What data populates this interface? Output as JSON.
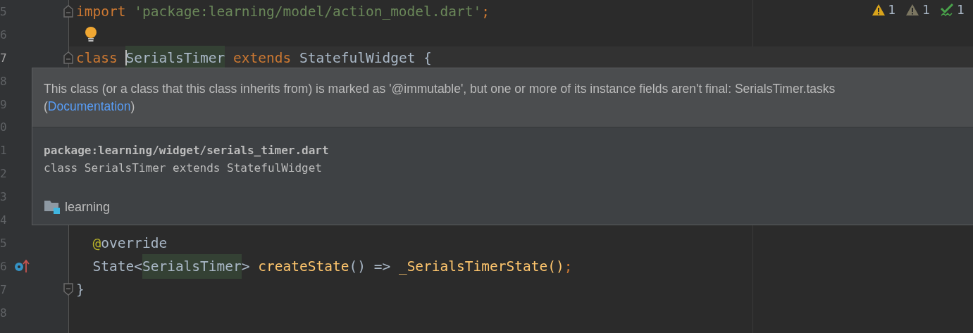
{
  "editor": {
    "inspections": [
      {
        "kind": "warning",
        "count": "1"
      },
      {
        "kind": "weak_warning",
        "count": "1"
      },
      {
        "kind": "typo",
        "count": "1"
      }
    ],
    "lines": [
      {
        "number": "5",
        "current": false,
        "markers": [
          {
            "kind": "fold_start"
          }
        ],
        "tokens": [
          {
            "text": "import",
            "kind": "keyword"
          },
          {
            "text": " 'package:learning/model/action_model.dart'",
            "kind": "string"
          },
          {
            "text": ";",
            "kind": "keyword"
          }
        ]
      },
      {
        "number": "6",
        "current": false,
        "markers": [
          {
            "kind": "bulb"
          }
        ]
      },
      {
        "number": "7",
        "current": true,
        "markers": [
          {
            "kind": "fold_start"
          },
          {
            "kind": "caret"
          }
        ],
        "tokens": [
          {
            "text": "class ",
            "kind": "keyword"
          },
          {
            "text": "SerialsTimer",
            "kind": "usage"
          },
          {
            "text": " extends",
            "kind": "keyword"
          },
          {
            "text": " StatefulWidget {",
            "kind": "plain"
          }
        ]
      },
      {
        "number": "8",
        "current": false
      },
      {
        "number": "9",
        "current": false
      },
      {
        "number": "0",
        "current": false
      },
      {
        "number": "1",
        "current": false
      },
      {
        "number": "2",
        "current": false
      },
      {
        "number": "3",
        "current": false
      },
      {
        "number": "4",
        "current": false
      },
      {
        "number": "5",
        "current": false,
        "tokens": [
          {
            "text": "  @",
            "kind": "annotation"
          },
          {
            "text": "override",
            "kind": "plain"
          }
        ]
      },
      {
        "number": "6",
        "current": false,
        "markers": [
          {
            "kind": "override"
          }
        ],
        "tokens": [
          {
            "text": "  State<",
            "kind": "plain"
          },
          {
            "text": "SerialsTimer",
            "kind": "usage"
          },
          {
            "text": "> ",
            "kind": "plain"
          },
          {
            "text": "createState",
            "kind": "method"
          },
          {
            "text": "() => ",
            "kind": "plain"
          },
          {
            "text": "_SerialsTimerState()",
            "kind": "method"
          },
          {
            "text": ";",
            "kind": "keyword"
          }
        ]
      },
      {
        "number": "7",
        "current": false,
        "markers": [
          {
            "kind": "fold_end"
          }
        ],
        "tokens": [
          {
            "text": "}",
            "kind": "plain"
          }
        ]
      },
      {
        "number": "8",
        "current": false
      }
    ]
  },
  "popup": {
    "message": "This class (or a class that this class inherits from) is marked as '@immutable', but one or more of its instance fields aren't final: SerialsTimer.tasks",
    "link_before": "(",
    "link": "Documentation",
    "link_after": ")",
    "path": "package:learning/widget/serials_timer.dart",
    "signature": "class SerialsTimer extends StatefulWidget",
    "module": "learning"
  }
}
